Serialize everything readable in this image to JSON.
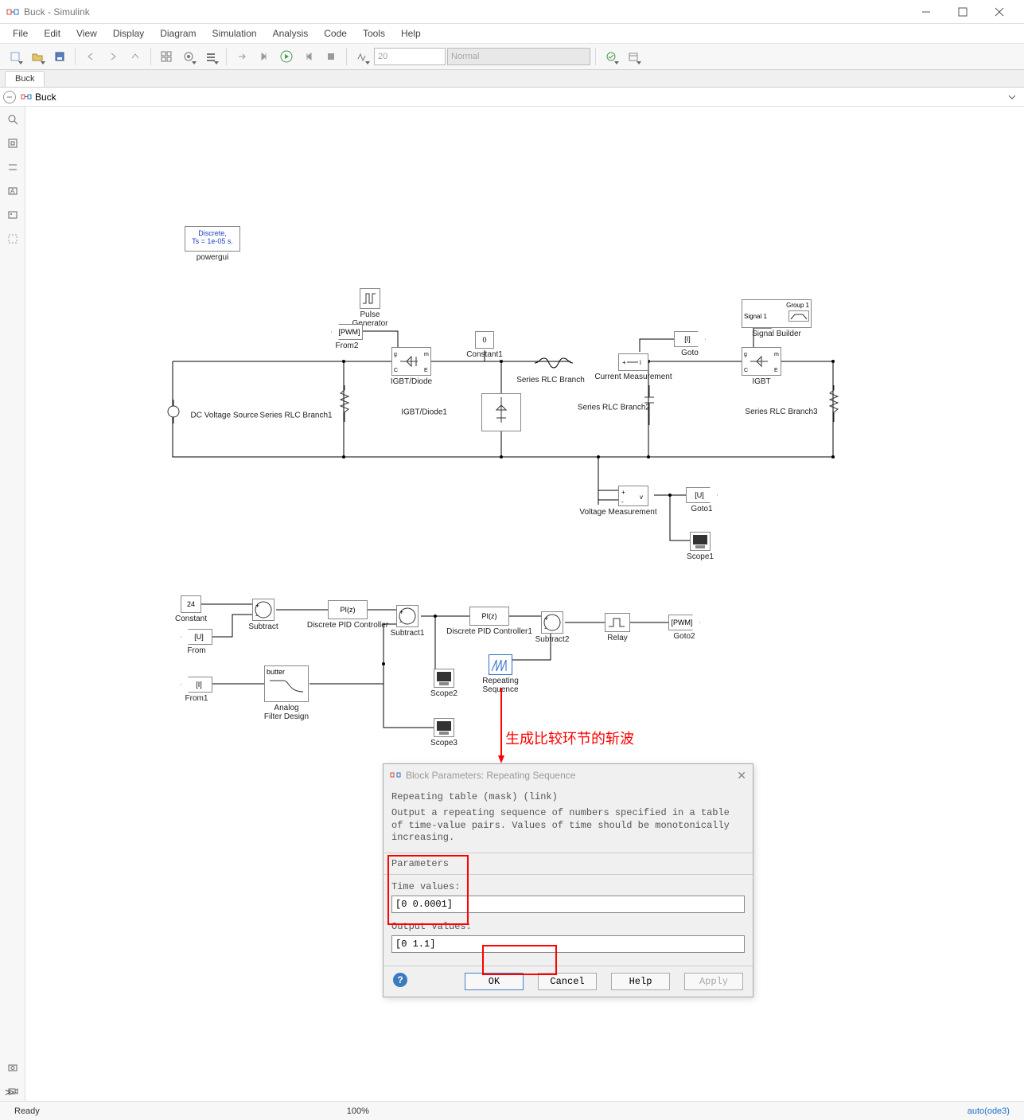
{
  "window": {
    "title": "Buck - Simulink"
  },
  "menu": [
    "File",
    "Edit",
    "View",
    "Display",
    "Diagram",
    "Simulation",
    "Analysis",
    "Code",
    "Tools",
    "Help"
  ],
  "toolbar": {
    "stop_time": "20",
    "sim_mode": "Normal"
  },
  "tabs": {
    "active": "Buck"
  },
  "breadcrumb": {
    "model": "Buck"
  },
  "blocks": {
    "powergui_line1": "Discrete,",
    "powergui_line2": "Ts = 1e-05 s.",
    "powergui_label": "powergui",
    "pulse_gen": "Pulse\nGenerator",
    "from2_tag": "[PWM]",
    "from2_label": "From2",
    "igbt_diode": "IGBT/Diode",
    "constant1_val": "0",
    "constant1_label": "Constant1",
    "dc_src": "DC Voltage Source",
    "rlc1": "Series RLC Branch1",
    "rlc": "Series RLC Branch",
    "igbt_diode1": "IGBT/Diode1",
    "curr_meas": "Current Measurement",
    "goto_tag": "[I]",
    "goto_label": "Goto",
    "rlc2": "Series RLC Branch2",
    "sig_builder_g": "Group 1",
    "sig_builder_s": "Signal 1",
    "sig_builder_label": "Signal Builder",
    "igbt": "IGBT",
    "rlc3": "Series RLC Branch3",
    "volt_meas": "Voltage Measurement",
    "goto1_tag": "[U]",
    "goto1_label": "Goto1",
    "scope1": "Scope1",
    "constant_val": "24",
    "constant_label": "Constant",
    "from_tag": "[U]",
    "from_label": "From",
    "from1_tag": "[I]",
    "from1_label": "From1",
    "subtract": "Subtract",
    "pid_txt": "PI(z)",
    "pid_label": "Discrete PID Controller",
    "subtract1": "Subtract1",
    "pid1_label": "Discrete PID Controller1",
    "subtract2": "Subtract2",
    "relay": "Relay",
    "goto2_tag": "[PWM]",
    "goto2_label": "Goto2",
    "filter_txt": "butter",
    "filter_label": "Analog\nFilter Design",
    "scope2": "Scope2",
    "scope3": "Scope3",
    "repseq": "Repeating\nSequence"
  },
  "annotation": {
    "text": "生成比较环节的斩波"
  },
  "dialog": {
    "title": "Block Parameters: Repeating Sequence",
    "desc_head": "Repeating table (mask) (link)",
    "desc_body": "Output a repeating sequence of numbers specified in a table of time-value pairs. Values of time should be monotonically increasing.",
    "params_label": "Parameters",
    "time_label": "Time values:",
    "time_value": "[0 0.0001]",
    "out_label": "Output values:",
    "out_value": "[0 1.1]",
    "btn_ok": "OK",
    "btn_cancel": "Cancel",
    "btn_help": "Help",
    "btn_apply": "Apply"
  },
  "status": {
    "ready": "Ready",
    "zoom": "100%",
    "solver": "auto(ode3)"
  }
}
